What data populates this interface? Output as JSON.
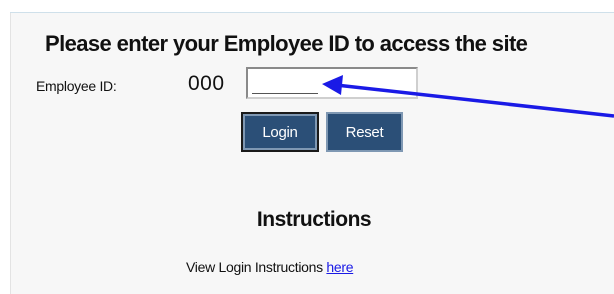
{
  "login": {
    "heading": "Please enter your Employee ID to access the site",
    "employee_id_label": "Employee ID:",
    "employee_id_prefix": "000",
    "employee_id_value": "",
    "login_label": "Login",
    "reset_label": "Reset"
  },
  "instructions": {
    "title": "Instructions",
    "text": "View Login Instructions ",
    "link_label": "here"
  },
  "colors": {
    "button_bg": "#2b4f77",
    "annotation_arrow": "#1a1ae6",
    "link": "#1a1ae6"
  },
  "icons": {
    "annotation": "arrow-pointer-icon"
  }
}
